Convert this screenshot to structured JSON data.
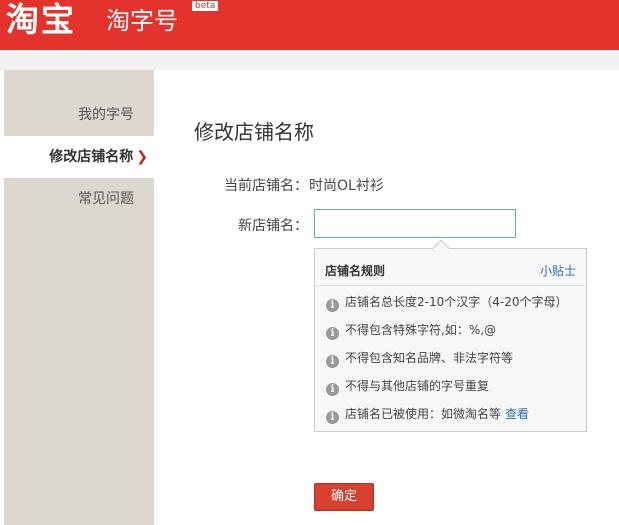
{
  "header": {
    "logo_text": "淘宝",
    "subbrand": "淘字号",
    "beta_badge": "beta"
  },
  "sidebar": {
    "items": [
      {
        "label": "我的字号",
        "active": false
      },
      {
        "label": "修改店铺名称",
        "active": true
      },
      {
        "label": "常见问题",
        "active": false
      }
    ]
  },
  "main": {
    "title": "修改店铺名称",
    "current_label": "当前店铺名：",
    "current_value": "时尚OL衬衫",
    "new_label": "新店铺名：",
    "new_value": "",
    "confirm_label": "确定"
  },
  "popover": {
    "title": "店铺名规则",
    "tip_link": "小贴士",
    "rules": [
      "店铺名总长度2-10个汉字（4-20个字母）",
      "不得包含特殊字符,如：%,@",
      "不得包含知名品牌、非法字符等",
      "不得与其他店铺的字号重复",
      "店铺名已被使用：如微淘名等"
    ],
    "view_link": "查看"
  },
  "colors": {
    "header_red": "#e3332c",
    "sidebar_bg": "#dcd8cf",
    "link_blue": "#2a6ea8",
    "button_red": "#d6402f"
  }
}
